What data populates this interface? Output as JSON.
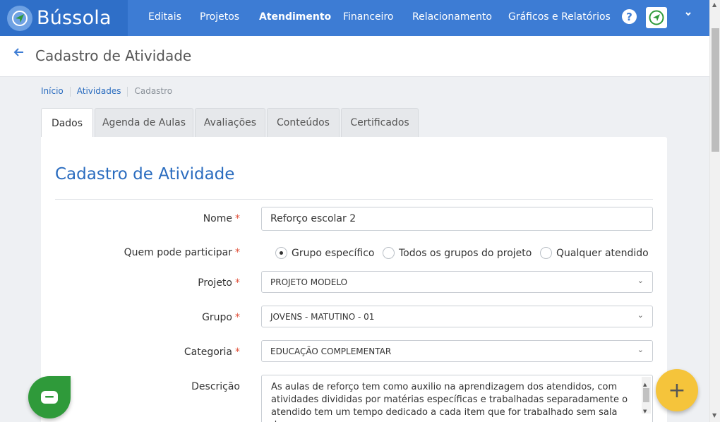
{
  "brand": {
    "name": "Bússola"
  },
  "nav": {
    "items": [
      "Editais",
      "Projetos",
      "Atendimento",
      "Financeiro",
      "Relacionamento",
      "Gráficos e Relatórios"
    ],
    "active": "Atendimento",
    "help": "?"
  },
  "header": {
    "title": "Cadastro de Atividade"
  },
  "breadcrumb": [
    "Início",
    "Atividades",
    "Cadastro"
  ],
  "tabs": [
    "Dados",
    "Agenda de Aulas",
    "Avaliações",
    "Conteúdos",
    "Certificados"
  ],
  "form": {
    "title": "Cadastro de Atividade",
    "nome_label": "Nome",
    "nome_value": "Reforço escolar 2",
    "participar_label": "Quem pode participar",
    "participar_options": [
      "Grupo específico",
      "Todos os grupos do projeto",
      "Qualquer atendido"
    ],
    "participar_selected": "Grupo específico",
    "projeto_label": "Projeto",
    "projeto_value": "PROJETO MODELO",
    "grupo_label": "Grupo",
    "grupo_value": "JOVENS - MATUTINO - 01",
    "categoria_label": "Categoria",
    "categoria_value": "EDUCAÇÃO COMPLEMENTAR",
    "descricao_label": "Descrição",
    "descricao_value": "As aulas de reforço tem como auxilio na aprendizagem dos atendidos, com atividades divididas por matérias específicas e trabalhadas separadamente o atendido tem um tempo dedicado a cada item que for trabalhado sem sala de",
    "required_mark": "*"
  },
  "fab": {
    "label": "+"
  },
  "colors": {
    "nav": "#3d7cd4",
    "brand_bg": "#2f6fc8",
    "accent": "#2a6cbf",
    "fab": "#f5c43b",
    "chat": "#2f9a3a",
    "required": "#e0513a"
  }
}
